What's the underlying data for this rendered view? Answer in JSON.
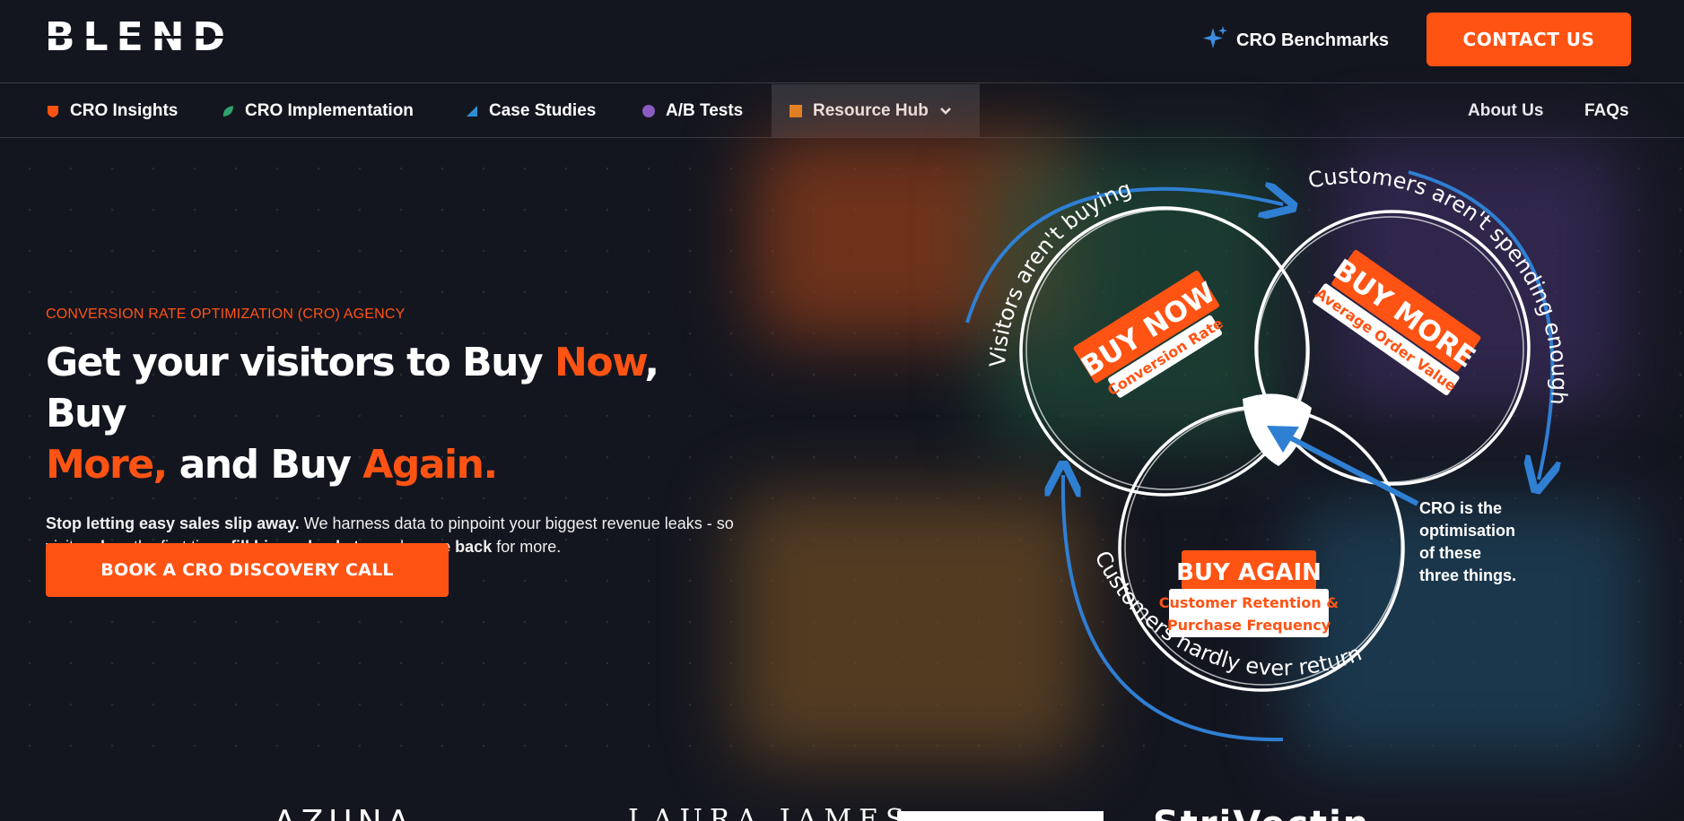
{
  "header": {
    "logo_text": "BLEND",
    "benchmarks_label": "CRO Benchmarks",
    "contact_label": "CONTACT US"
  },
  "nav": {
    "items": [
      {
        "label": "CRO Insights",
        "color": "#ff5314"
      },
      {
        "label": "CRO Implementation",
        "color": "#2fa36b"
      },
      {
        "label": "Case Studies",
        "color": "#2c8fd6"
      },
      {
        "label": "A/B Tests",
        "color": "#8a5cc2"
      },
      {
        "label": "Resource Hub",
        "color": "#f28c28"
      }
    ],
    "right": [
      "About Us",
      "FAQs"
    ]
  },
  "hero": {
    "eyebrow": "CONVERSION RATE OPTIMIZATION (CRO) AGENCY",
    "headline": {
      "p1": "Get your visitors to Buy ",
      "now": "Now",
      "p2": ", Buy",
      "more": "More,",
      "p3": " and Buy ",
      "again": "Again."
    },
    "desc": {
      "b1": "Stop letting easy sales slip away.",
      "t1": " We harness data to pinpoint your biggest revenue leaks - so visitors ",
      "b2": "buy",
      "t2": " the first time, ",
      "b3": "fill bigger baskets,",
      "t3": " and ",
      "b4": "come back",
      "t4": " for more."
    },
    "cta_label": "BOOK A CRO DISCOVERY CALL"
  },
  "diagram": {
    "arc_top_left": "Visitors aren't buying",
    "arc_top_right": "Customers aren't spending enough",
    "arc_bottom": "Customers hardly ever return",
    "buy_now": "BUY NOW",
    "buy_now_sub": "Conversion Rate",
    "buy_more": "BUY MORE",
    "buy_more_sub": "Average Order Value",
    "buy_again": "BUY AGAIN",
    "buy_again_sub1": "Customer Retention &",
    "buy_again_sub2": "Purchase Frequency",
    "cro_note": [
      "CRO is the",
      "optimisation",
      "of these",
      "three things."
    ]
  },
  "logos_strip": [
    "AZUNA",
    "LAURA JAMES",
    "StriVectin"
  ],
  "colors": {
    "accent": "#ff5314",
    "background": "#14161f",
    "arrow_blue": "#2f7fd3"
  }
}
